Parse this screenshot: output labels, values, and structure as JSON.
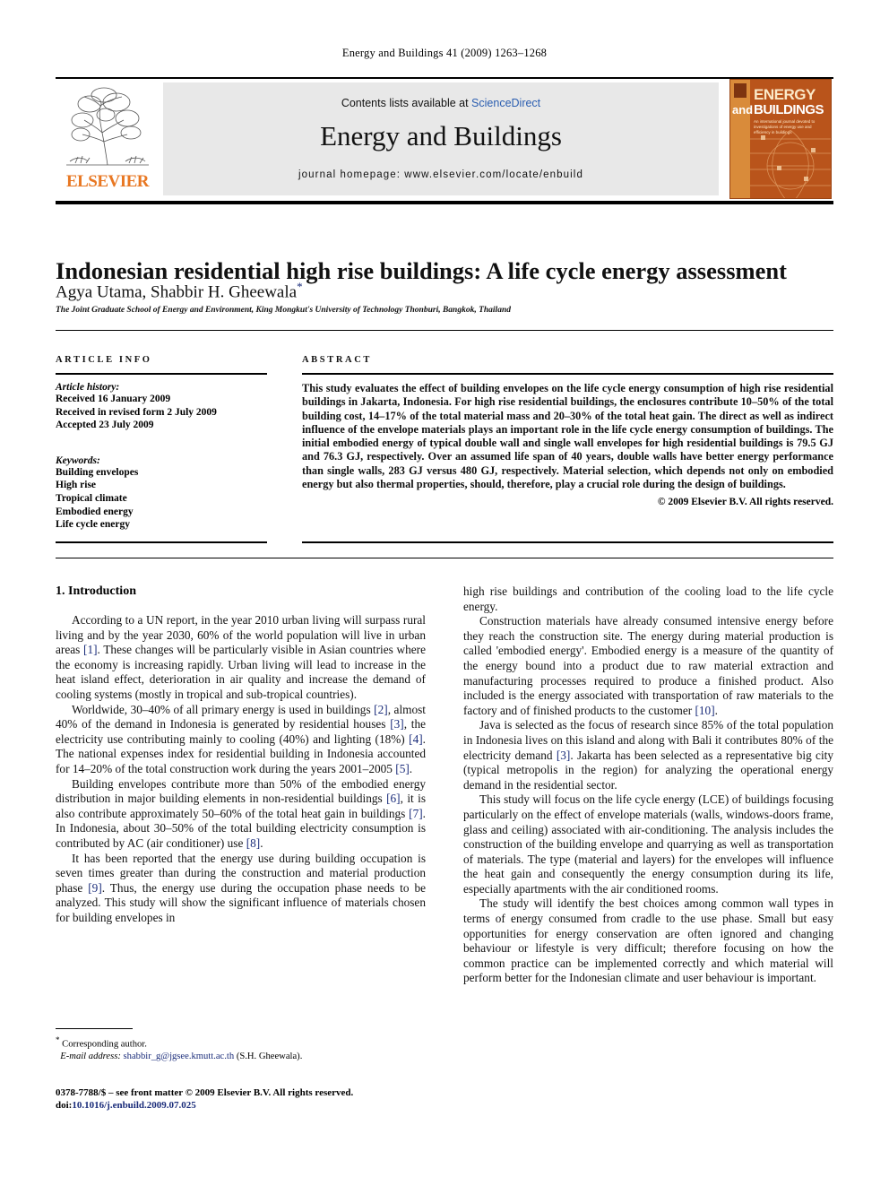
{
  "running_head": "Energy and Buildings 41 (2009) 1263–1268",
  "banner": {
    "publisher": "ELSEVIER",
    "contents_prefix": "Contents lists available at ",
    "contents_link": "ScienceDirect",
    "journal_title": "Energy and Buildings",
    "homepage": "journal homepage: www.elsevier.com/locate/enbuild",
    "cover": {
      "line1": "ENERGY",
      "and": "and",
      "line2": "BUILDINGS",
      "subtitle": "An international journal devoted to investigations of energy use and efficiency in buildings"
    }
  },
  "article": {
    "title": "Indonesian residential high rise buildings: A life cycle energy assessment",
    "authors": "Agya Utama, Shabbir H. Gheewala",
    "corresponding_marker": "*",
    "affiliation": "The Joint Graduate School of Energy and Environment, King Mongkut's University of Technology Thonburi, Bangkok, Thailand"
  },
  "article_info": {
    "label": "ARTICLE INFO",
    "history_heading": "Article history:",
    "history": [
      "Received 16 January 2009",
      "Received in revised form 2 July 2009",
      "Accepted 23 July 2009"
    ],
    "keywords_heading": "Keywords:",
    "keywords": [
      "Building envelopes",
      "High rise",
      "Tropical climate",
      "Embodied energy",
      "Life cycle energy"
    ]
  },
  "abstract": {
    "label": "ABSTRACT",
    "text": "This study evaluates the effect of building envelopes on the life cycle energy consumption of high rise residential buildings in Jakarta, Indonesia. For high rise residential buildings, the enclosures contribute 10–50% of the total building cost, 14–17% of the total material mass and 20–30% of the total heat gain. The direct as well as indirect influence of the envelope materials plays an important role in the life cycle energy consumption of buildings. The initial embodied energy of typical double wall and single wall envelopes for high residential buildings is 79.5 GJ and 76.3 GJ, respectively. Over an assumed life span of 40 years, double walls have better energy performance than single walls, 283 GJ versus 480 GJ, respectively. Material selection, which depends not only on embodied energy but also thermal properties, should, therefore, play a crucial role during the design of buildings.",
    "copyright": "© 2009 Elsevier B.V. All rights reserved."
  },
  "introduction": {
    "heading": "1. Introduction",
    "left_paragraphs": [
      "According to a UN report, in the year 2010 urban living will surpass rural living and by the year 2030, 60% of the world population will live in urban areas [1]. These changes will be particularly visible in Asian countries where the economy is increasing rapidly. Urban living will lead to increase in the heat island effect, deterioration in air quality and increase the demand of cooling systems (mostly in tropical and sub-tropical countries).",
      "Worldwide, 30–40% of all primary energy is used in buildings [2], almost 40% of the demand in Indonesia is generated by residential houses [3], the electricity use contributing mainly to cooling (40%) and lighting (18%) [4]. The national expenses index for residential building in Indonesia accounted for 14–20% of the total construction work during the years 2001–2005 [5].",
      "Building envelopes contribute more than 50% of the embodied energy distribution in major building elements in non-residential buildings [6], it is also contribute approximately 50–60% of the total heat gain in buildings [7]. In Indonesia, about 30–50% of the total building electricity consumption is contributed by AC (air conditioner) use [8].",
      "It has been reported that the energy use during building occupation is seven times greater than during the construction and material production phase [9]. Thus, the energy use during the occupation phase needs to be analyzed. This study will show the significant influence of materials chosen for building envelopes in"
    ],
    "right_paragraphs": [
      "high rise buildings and contribution of the cooling load to the life cycle energy.",
      "Construction materials have already consumed intensive energy before they reach the construction site. The energy during material production is called 'embodied energy'. Embodied energy is a measure of the quantity of the energy bound into a product due to raw material extraction and manufacturing processes required to produce a finished product. Also included is the energy associated with transportation of raw materials to the factory and of finished products to the customer [10].",
      "Java is selected as the focus of research since 85% of the total population in Indonesia lives on this island and along with Bali it contributes 80% of the electricity demand [3]. Jakarta has been selected as a representative big city (typical metropolis in the region) for analyzing the operational energy demand in the residential sector.",
      "This study will focus on the life cycle energy (LCE) of buildings focusing particularly on the effect of envelope materials (walls, windows-doors frame, glass and ceiling) associated with air-conditioning. The analysis includes the construction of the building envelope and quarrying as well as transportation of materials. The type (material and layers) for the envelopes will influence the heat gain and consequently the energy consumption during its life, especially apartments with the air conditioned rooms.",
      "The study will identify the best choices among common wall types in terms of energy consumed from cradle to the use phase. Small but easy opportunities for energy conservation are often ignored and changing behaviour or lifestyle is very difficult; therefore focusing on how the common practice can be implemented correctly and which material will perform better for the Indonesian climate and user behaviour is important."
    ]
  },
  "footnote": {
    "corresponding": "Corresponding author.",
    "email_label": "E-mail address:",
    "email": "shabbir_g@jgsee.kmutt.ac.th",
    "email_owner": "(S.H. Gheewala)."
  },
  "imprint": {
    "line1": "0378-7788/$ – see front matter © 2009 Elsevier B.V. All rights reserved.",
    "doi_prefix": "doi:",
    "doi": "10.1016/j.enbuild.2009.07.025"
  }
}
